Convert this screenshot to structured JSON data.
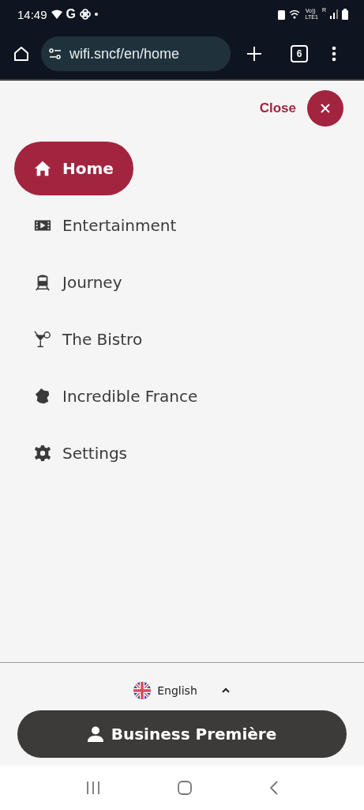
{
  "status_bar": {
    "time": "14:49",
    "carrier_letter": "G",
    "network_label": "Vo))\nLTE1",
    "roaming_label": "R"
  },
  "browser": {
    "url": "wifi.sncf/en/home",
    "tab_count": "6"
  },
  "close": {
    "label": "Close"
  },
  "menu": [
    {
      "label": "Home",
      "kind": "home",
      "selected": true
    },
    {
      "label": "Entertainment",
      "kind": "film",
      "selected": false
    },
    {
      "label": "Journey",
      "kind": "train",
      "selected": false
    },
    {
      "label": "The Bistro",
      "kind": "cocktail",
      "selected": false
    },
    {
      "label": "Incredible France",
      "kind": "map",
      "selected": false
    },
    {
      "label": "Settings",
      "kind": "gear",
      "selected": false
    }
  ],
  "language": {
    "label": "English",
    "expanded": false
  },
  "account_button": {
    "label": "Business Première"
  }
}
